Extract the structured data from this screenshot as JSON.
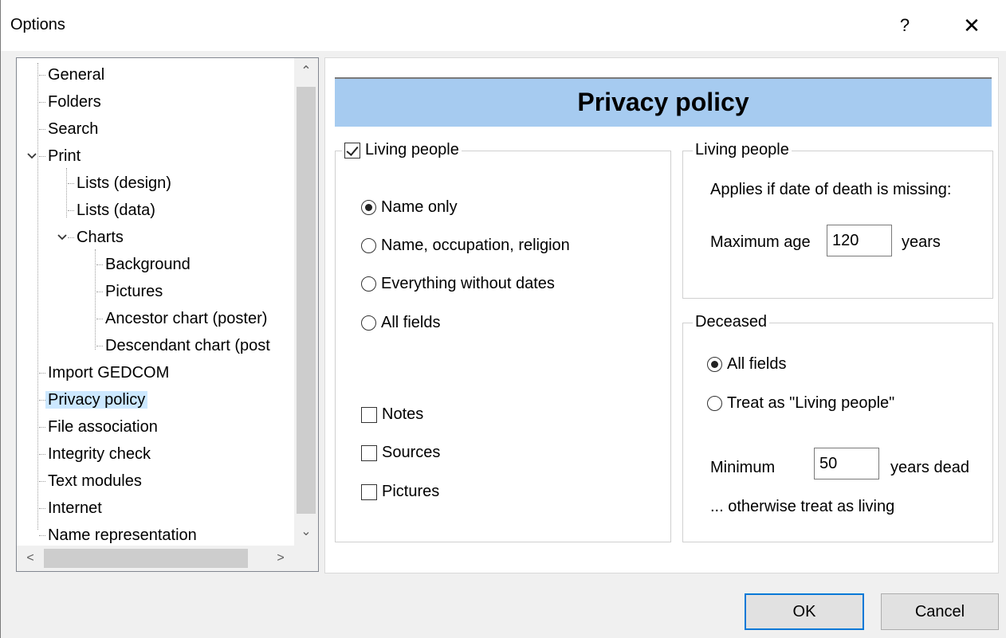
{
  "window": {
    "title": "Options",
    "help_glyph": "?",
    "close_glyph": "✕"
  },
  "tree": {
    "items": [
      {
        "label": "General"
      },
      {
        "label": "Folders"
      },
      {
        "label": "Search"
      },
      {
        "label": "Print",
        "expanded": true
      },
      {
        "label": "Lists (design)"
      },
      {
        "label": "Lists (data)"
      },
      {
        "label": "Charts",
        "expanded": true
      },
      {
        "label": "Background"
      },
      {
        "label": "Pictures"
      },
      {
        "label": "Ancestor chart (poster)"
      },
      {
        "label": "Descendant chart (post"
      },
      {
        "label": "Import GEDCOM"
      },
      {
        "label": "Privacy policy",
        "selected": true
      },
      {
        "label": "File association"
      },
      {
        "label": "Integrity check"
      },
      {
        "label": "Text modules"
      },
      {
        "label": "Internet"
      },
      {
        "label": "Name representation"
      }
    ],
    "scroll_up_glyph": "⌃",
    "scroll_down_glyph": "⌄",
    "scroll_left_glyph": "<",
    "scroll_right_glyph": ">"
  },
  "page": {
    "header": "Privacy policy",
    "living_group": {
      "legend": "Living people",
      "checked": true,
      "options": [
        {
          "label": "Name only",
          "selected": true
        },
        {
          "label": "Name, occupation, religion",
          "selected": false
        },
        {
          "label": "Everything without dates",
          "selected": false
        },
        {
          "label": "All fields",
          "selected": false
        }
      ],
      "checkboxes": [
        {
          "label": "Notes",
          "checked": false
        },
        {
          "label": "Sources",
          "checked": false
        },
        {
          "label": "Pictures",
          "checked": false
        }
      ]
    },
    "living_rule": {
      "legend": "Living people",
      "note": "Applies if date of death is missing:",
      "max_age_label": "Maximum age",
      "max_age_value": "120",
      "max_age_unit": "years"
    },
    "deceased": {
      "legend": "Deceased",
      "options": [
        {
          "label": "All fields",
          "selected": true
        },
        {
          "label": "Treat as \"Living people\"",
          "selected": false
        }
      ],
      "min_label": "Minimum",
      "min_value": "50",
      "min_unit": "years dead",
      "otherwise": "... otherwise treat as living"
    }
  },
  "buttons": {
    "ok": "OK",
    "cancel": "Cancel"
  },
  "colors": {
    "header_bg": "#a6cbf0",
    "selection_bg": "#cce8ff",
    "default_button_border": "#0078d7"
  }
}
